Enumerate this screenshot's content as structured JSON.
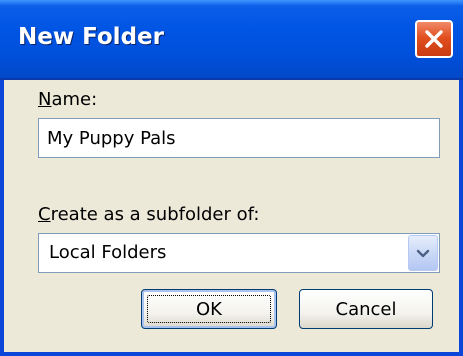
{
  "window": {
    "title": "New Folder"
  },
  "name_field": {
    "label_accel": "N",
    "label_rest": "ame:",
    "value": "My Puppy Pals"
  },
  "subfolder_field": {
    "label_accel": "C",
    "label_rest": "reate as a subfolder of:",
    "selected": "Local Folders"
  },
  "buttons": {
    "ok": "OK",
    "cancel": "Cancel"
  },
  "icons": {
    "close": "close-icon",
    "dropdown": "chevron-down-icon"
  },
  "colors": {
    "titlebar": "#0054e3",
    "window_bg": "#ece9d8",
    "close_button": "#e2501f",
    "field_border": "#7f9db9"
  }
}
